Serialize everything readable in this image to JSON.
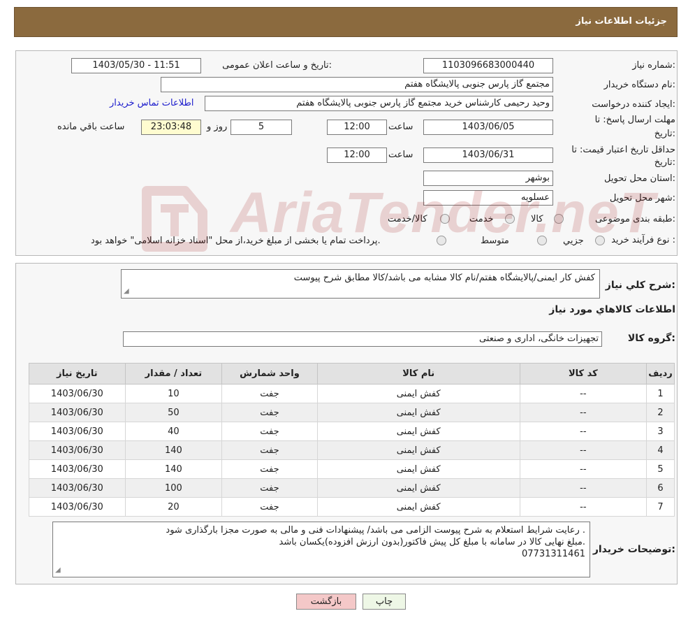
{
  "header": {
    "title": "جزئیات اطلاعات نیاز"
  },
  "form": {
    "need_number_label": "شماره نیاز:",
    "need_number": "1103096683000440",
    "announce_label": "تاریخ و ساعت اعلان عمومی:",
    "announce_value": "1403/05/30 - 11:51",
    "buyer_org_label": "نام دستگاه خریدار:",
    "buyer_org": "مجتمع گاز پارس جنوبی  پالایشگاه هفتم",
    "creator_label": "ایجاد کننده درخواست:",
    "creator": "وحید رحیمی کارشناس خرید مجتمع گاز پارس جنوبی  پالایشگاه هفتم",
    "contact_link": "اطلاعات تماس خریدار",
    "deadline_label_1": "مهلت ارسال پاسخ: تا",
    "deadline_label_2": "تاریخ:",
    "deadline_date": "1403/06/05",
    "time_label": "ساعت",
    "deadline_time": "12:00",
    "days_value": "5",
    "days_label": "روز و",
    "remaining_time": "23:03:48",
    "remaining_label": "ساعت باقي مانده",
    "validity_label_1": "حداقل تاریخ اعتبار قیمت: تا",
    "validity_label_2": "تاریخ:",
    "validity_date": "1403/06/31",
    "validity_time": "12:00",
    "province_label": "استان محل تحویل:",
    "province": "بوشهر",
    "city_label": "شهر محل تحویل:",
    "city": "عسلویه",
    "category_label": "طبقه بندی موضوعی:",
    "category_options": [
      "کالا",
      "خدمت",
      "کالا/خدمت"
    ],
    "process_label": "نوع فرآیند خرید :",
    "process_options": [
      "جزیي",
      "متوسط"
    ],
    "process_note": "پرداخت تمام یا بخشی از مبلغ خرید،از محل \"اسناد خزانه اسلامی\" خواهد بود."
  },
  "watermark": {
    "text": "AriaTender.neT"
  },
  "summary": {
    "label": "شرح کلي نیاز:",
    "value": "کفش کار ایمنی/پالایشگاه هفتم/نام کالا مشابه می باشد/کالا مطابق شرح پیوست",
    "section_title": "اطلاعات کالاهاي مورد نیاز",
    "group_label": "گروه کالا:",
    "group_value": "تجهیزات خانگی، اداری و صنعتی"
  },
  "table": {
    "headers": [
      "ردیف",
      "کد کالا",
      "نام کالا",
      "واحد شمارش",
      "تعداد / مقدار",
      "تاریخ نیاز"
    ],
    "rows": [
      [
        "1",
        "--",
        "کفش ایمنی",
        "جفت",
        "10",
        "1403/06/30"
      ],
      [
        "2",
        "--",
        "کفش ایمنی",
        "جفت",
        "50",
        "1403/06/30"
      ],
      [
        "3",
        "--",
        "کفش ایمنی",
        "جفت",
        "40",
        "1403/06/30"
      ],
      [
        "4",
        "--",
        "کفش ایمنی",
        "جفت",
        "140",
        "1403/06/30"
      ],
      [
        "5",
        "--",
        "کفش ایمنی",
        "جفت",
        "140",
        "1403/06/30"
      ],
      [
        "6",
        "--",
        "کفش ایمنی",
        "جفت",
        "100",
        "1403/06/30"
      ],
      [
        "7",
        "--",
        "کفش ایمنی",
        "جفت",
        "20",
        "1403/06/30"
      ]
    ]
  },
  "notes": {
    "label": "توضیحات خریدار:",
    "lines": [
      "رعایت شرایط استعلام به شرح پیوست الزامی می باشد/ پیشنهادات فنی و مالی به صورت مجزا بارگذاری شود .",
      "مبلغ نهایی کالا در سامانه با مبلغ کل پیش فاکتور(بدون ارزش افزوده)یکسان باشد.",
      "07731311461"
    ]
  },
  "buttons": {
    "print": "چاپ",
    "back": "بازگشت"
  },
  "colors": {
    "header": "#8b6a3e",
    "back_button": "#f4c8c8",
    "print_button": "#eef7e6"
  }
}
